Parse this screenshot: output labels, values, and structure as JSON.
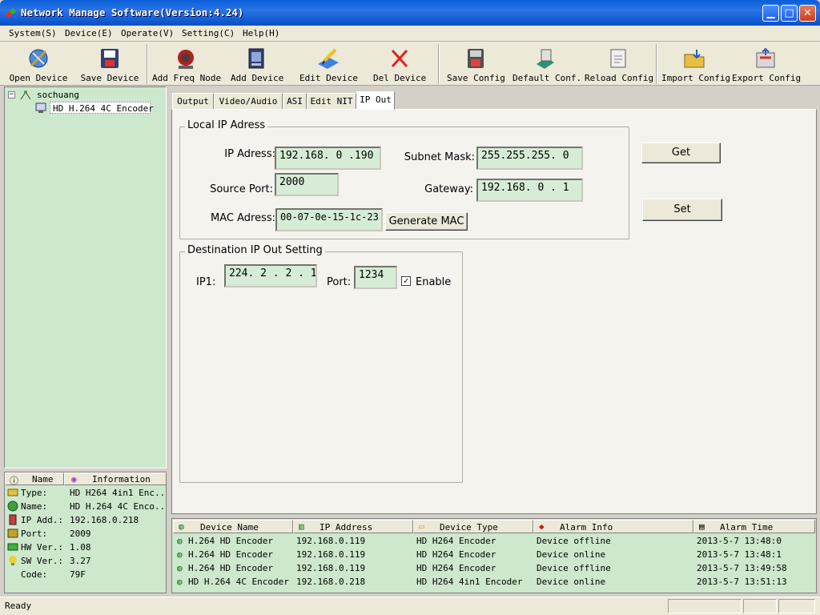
{
  "window": {
    "title": "Network Manage Software(Version:4.24)"
  },
  "menu": [
    "System(S)",
    "Device(E)",
    "Operate(V)",
    "Setting(C)",
    "Help(H)"
  ],
  "toolbar": [
    "Open Device",
    "Save Device",
    "Add Freq Node",
    "Add Device",
    "Edit Device",
    "Del Device",
    "Save Config",
    "Default Conf.",
    "Reload Config",
    "Import Config",
    "Export Config"
  ],
  "tree": {
    "root": "sochuang",
    "child": "HD H.264 4C Encoder"
  },
  "info": {
    "headers": [
      "Name",
      "Information"
    ],
    "rows": [
      {
        "key": "Type:",
        "value": "HD H264 4in1 Enc..."
      },
      {
        "key": "Name:",
        "value": "HD H.264 4C Enco..."
      },
      {
        "key": "IP Add.:",
        "value": "192.168.0.218"
      },
      {
        "key": "Port:",
        "value": "2009"
      },
      {
        "key": "HW Ver.:",
        "value": "1.08"
      },
      {
        "key": "SW Ver.:",
        "value": "3.27"
      },
      {
        "key": "Code:",
        "value": "79F"
      }
    ]
  },
  "tabs": [
    "Output",
    "Video/Audio",
    "ASI",
    "Edit NIT",
    "IP Out"
  ],
  "local_ip": {
    "group_title": "Local IP Adress",
    "ip_label": "IP Adress:",
    "ip_value": "192.168. 0 .190",
    "mask_label": "Subnet Mask:",
    "mask_value": "255.255.255. 0",
    "port_label": "Source Port:",
    "port_value": "2000",
    "gateway_label": "Gateway:",
    "gateway_value": "192.168. 0 . 1",
    "mac_label": "MAC Adress:",
    "mac_value": "00-07-0e-15-1c-23",
    "generate_mac": "Generate MAC"
  },
  "dest": {
    "group_title": "Destination IP Out Setting",
    "ip1_label": "IP1:",
    "ip1_value": "224. 2 . 2 . 1",
    "port_label": "Port:",
    "port_value": "1234",
    "enable_label": "Enable",
    "enable_checked": true
  },
  "buttons": {
    "get": "Get",
    "set": "Set"
  },
  "alarms": {
    "headers": [
      "Device Name",
      "IP Address",
      "Device Type",
      "Alarm Info",
      "Alarm Time"
    ],
    "rows": [
      {
        "name": "H.264 HD Encoder",
        "ip": "192.168.0.119",
        "type": "HD H264 Encoder",
        "info": "Device offline",
        "time": "2013-5-7 13:48:0"
      },
      {
        "name": "H.264 HD Encoder",
        "ip": "192.168.0.119",
        "type": "HD H264 Encoder",
        "info": "Device online",
        "time": "2013-5-7 13:48:1"
      },
      {
        "name": "H.264 HD Encoder",
        "ip": "192.168.0.119",
        "type": "HD H264 Encoder",
        "info": "Device offline",
        "time": "2013-5-7 13:49:58"
      },
      {
        "name": "HD H.264 4C Encoder",
        "ip": "192.168.0.218",
        "type": "HD H264 4in1 Encoder",
        "info": "Device online",
        "time": "2013-5-7 13:51:13"
      }
    ]
  },
  "status": {
    "text": "Ready"
  }
}
